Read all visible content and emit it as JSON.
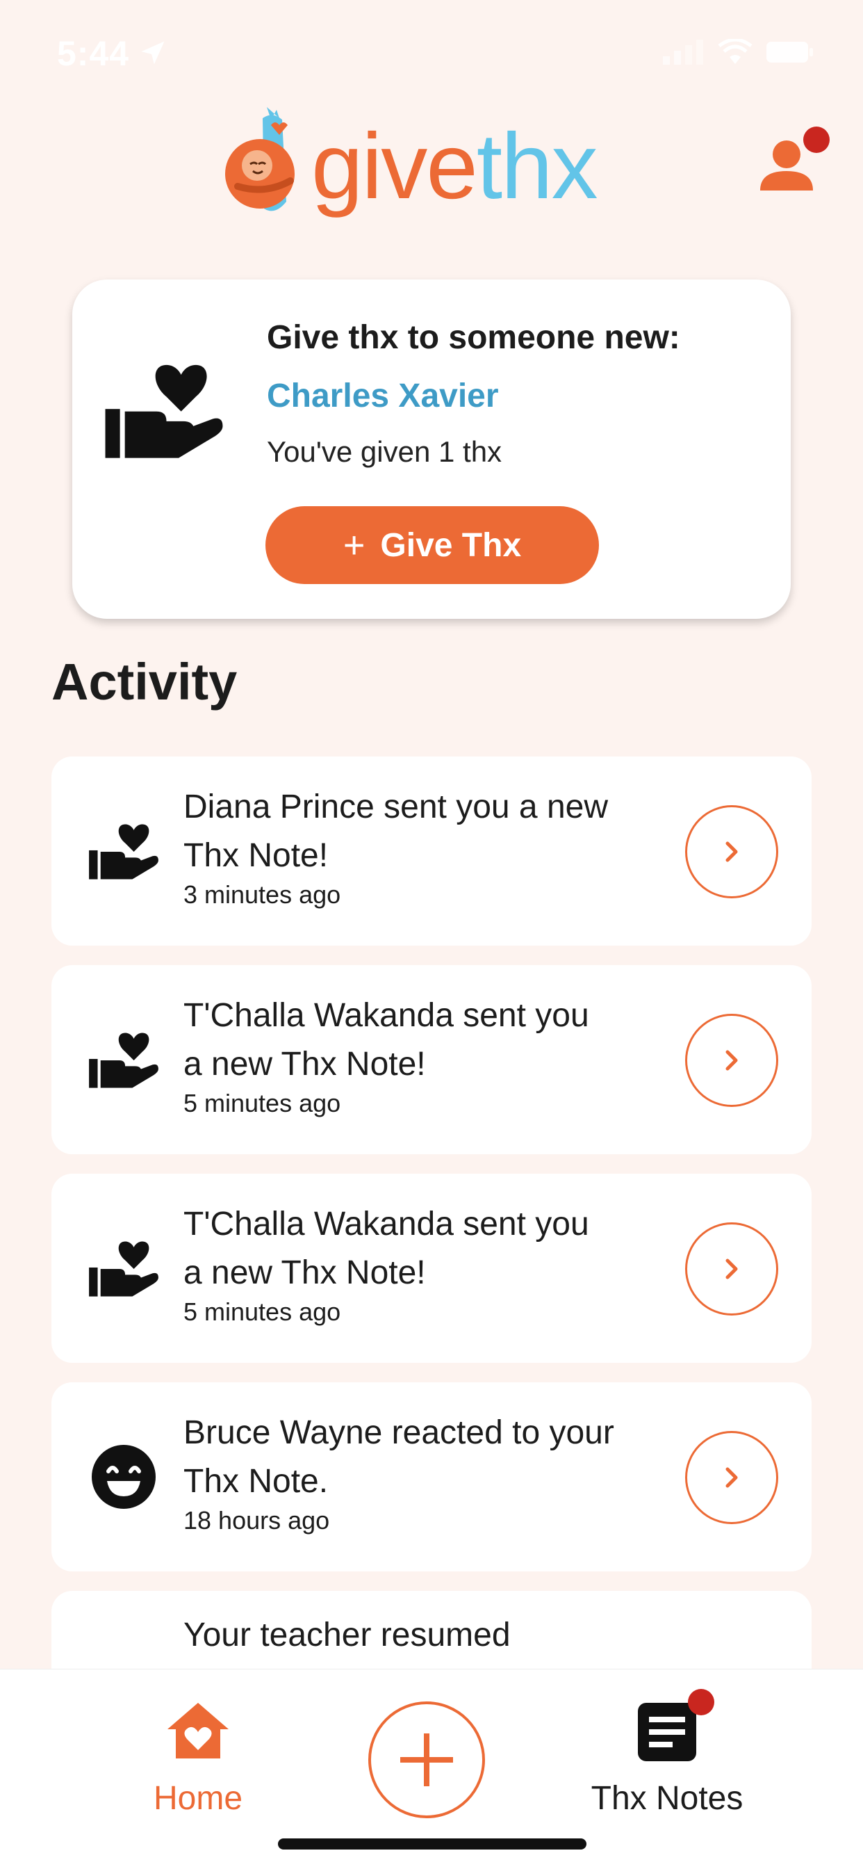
{
  "status_bar": {
    "time": "5:44"
  },
  "header": {
    "logo_part1": "give",
    "logo_part2": "thx"
  },
  "give_card": {
    "title": "Give thx to someone new:",
    "recipient": "Charles Xavier",
    "count_text": "You've given 1 thx",
    "button_plus": "+",
    "button_label": "Give Thx"
  },
  "activity": {
    "title": "Activity",
    "items": [
      {
        "text": "Diana Prince sent you a new Thx Note!",
        "time": "3 minutes ago",
        "icon": "hand-heart-icon"
      },
      {
        "text": "T'Challa Wakanda sent you a new Thx Note!",
        "time": "5 minutes ago",
        "icon": "hand-heart-icon"
      },
      {
        "text": "T'Challa Wakanda sent you a new Thx Note!",
        "time": "5 minutes ago",
        "icon": "hand-heart-icon"
      },
      {
        "text": "Bruce Wayne reacted to your Thx Note.",
        "time": "18 hours ago",
        "icon": "smiley-icon"
      },
      {
        "text": "Your teacher resumed"
      }
    ]
  },
  "tabbar": {
    "home_label": "Home",
    "notes_label": "Thx Notes"
  },
  "colors": {
    "accent": "#ec6a35",
    "link": "#3e9bc6",
    "logo_thx": "#62c4e8",
    "notification_dot": "#c9261f",
    "background": "#fdf3ef"
  }
}
